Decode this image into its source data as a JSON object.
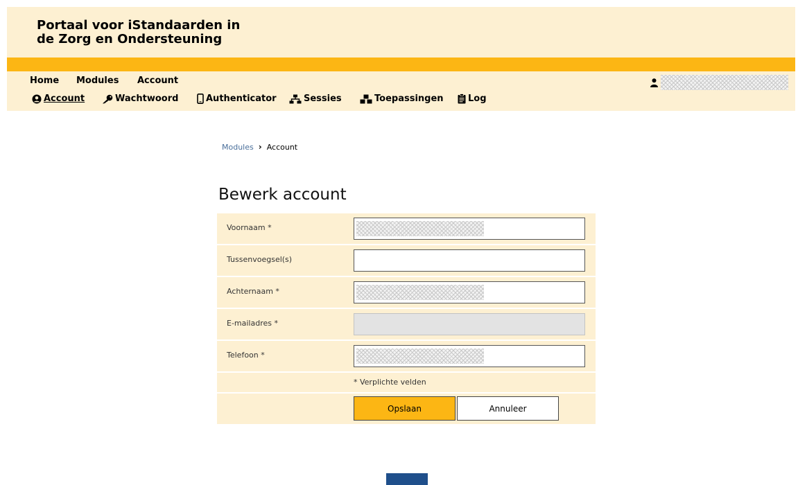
{
  "header": {
    "title": "Portaal voor iStandaarden in de Zorg en Ondersteuning",
    "main_nav": [
      "Home",
      "Modules",
      "Account"
    ],
    "sub_nav": [
      {
        "label": "Account",
        "icon": "user-circle-icon",
        "active": true
      },
      {
        "label": "Wachtwoord",
        "icon": "key-icon"
      },
      {
        "label": "Authenticator",
        "icon": "mobile-icon"
      },
      {
        "label": "Sessies",
        "icon": "sitemap-icon"
      },
      {
        "label": "Toepassingen",
        "icon": "cubes-icon"
      },
      {
        "label": "Log",
        "icon": "clipboard-icon"
      }
    ],
    "user_icon": "user-icon"
  },
  "breadcrumb": {
    "parent": "Modules",
    "separator": "›",
    "current": "Account"
  },
  "page_title": "Bewerk account",
  "form": {
    "fields": [
      {
        "label": "Voornaam *",
        "value": "",
        "masked": true
      },
      {
        "label": "Tussenvoegsel(s)",
        "value": ""
      },
      {
        "label": "Achternaam *",
        "value": "",
        "masked": true
      },
      {
        "label": "E-mailadres *",
        "value": "",
        "disabled": true
      },
      {
        "label": "Telefoon *",
        "value": "",
        "masked": true
      }
    ],
    "required_note": "* Verplichte velden",
    "save_label": "Opslaan",
    "cancel_label": "Annuleer"
  },
  "colors": {
    "accent": "#fcb614",
    "header_bg": "#fdf0d2",
    "link": "#4a6f9b",
    "footer_block": "#1f4f8b"
  }
}
